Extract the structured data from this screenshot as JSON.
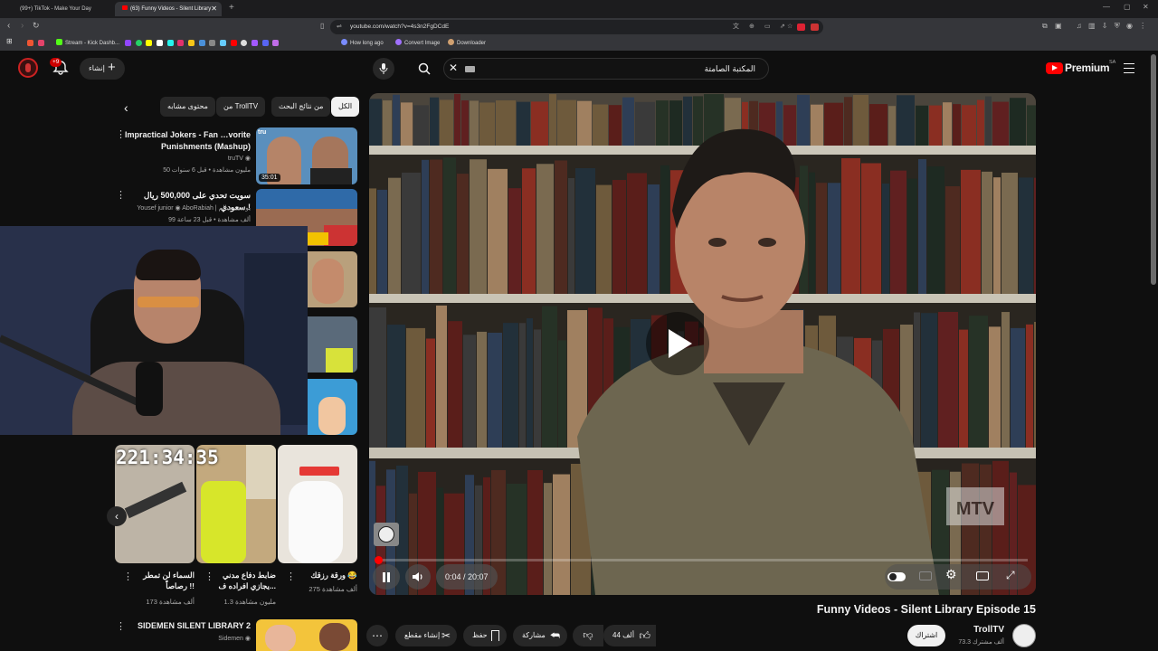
{
  "browser": {
    "tabs": [
      {
        "label": "(99+) TikTok - Make Your Day"
      },
      {
        "label": "(63) Funny Videos - Silent Library"
      }
    ],
    "url": "youtube.com/watch?v=4s3n2FgDCdE",
    "bookmarks": [
      {
        "label": "Stream - Kick Dashb...",
        "color": "#53fc18"
      },
      {
        "label": "How long ago",
        "color": "#7a8cff"
      },
      {
        "label": "Convert Image",
        "color": "#a070ff"
      },
      {
        "label": "Downloader",
        "color": "#d0a070"
      }
    ]
  },
  "youtube": {
    "logo_label": "Premium",
    "region": "SA",
    "search_value": "المكتبة الصامتة",
    "create_label": "إنشاء",
    "notif_count": "+9"
  },
  "chips": [
    {
      "label": "الكل",
      "selected": true
    },
    {
      "label": "من نتائج البحث"
    },
    {
      "label": "من TrollTV"
    },
    {
      "label": "محتوى مشابه"
    }
  ],
  "recommendations": [
    {
      "title": "Impractical Jokers - Fan Favorite Punishments (Mashup)",
      "title_display": "Impractical Jokers - Fan …vorite Punishments (Mashup)",
      "channel": "truTV",
      "meta": "50 مليون مشاهدة • قبل 6 سنوات",
      "duration": "35:01"
    },
    {
      "title": "سويت تحدي على 500,000 ريال سعودي !",
      "channel": "AboRabiah | يوسف سالم",
      "channel_extra": "Yousef junior",
      "meta": "99 ألف مشاهدة • قبل 23 ساعة"
    },
    {
      "title": "SIDEMEN SILENT LIBRARY 2",
      "channel": "Sidemen"
    }
  ],
  "shorts": [
    {
      "title": "ورقة رزقك 😂",
      "views": "275 ألف مشاهدة"
    },
    {
      "title": "ضابط دفاع مدني يجازي افراده ف...",
      "views": "1.3 مليون مشاهدة"
    },
    {
      "title": "السماء لن تمطر رصاصاً !!",
      "views": "173 ألف مشاهدة"
    }
  ],
  "webcam": {
    "timestamp": "221:34:35"
  },
  "player": {
    "time_current": "0:04",
    "time_total": "20:07",
    "time_display": "0:04 / 20:07",
    "progress": 0.0033,
    "watermark": "MTV"
  },
  "video": {
    "title": "Funny Videos - Silent Library Episode 15",
    "channel": "TrollTV",
    "subscribers": "73.3 ألف مشترك",
    "subscribe_label": "اشتراك",
    "likes": "44 ألف",
    "share_label": "مشاركة",
    "save_label": "حفظ",
    "clip_label": "إنشاء مقطع"
  }
}
